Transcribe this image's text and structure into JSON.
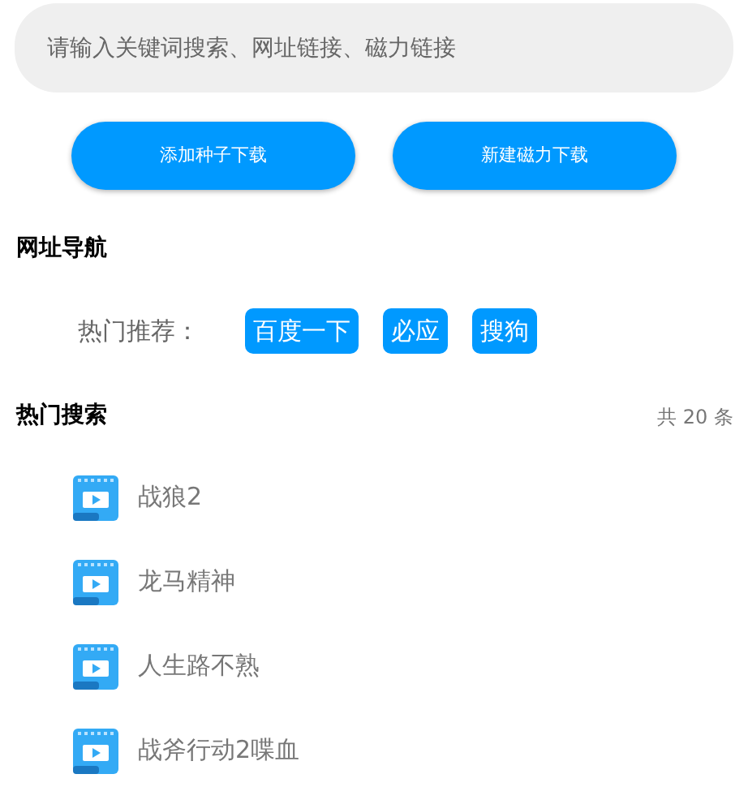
{
  "search": {
    "placeholder": "请输入关键词搜索、网址链接、磁力链接"
  },
  "buttons": [
    "添加种子下载",
    "新建磁力下载"
  ],
  "nav": {
    "title": "网址导航",
    "label": "热门推荐：",
    "links": [
      "百度一下",
      "必应",
      "搜狗"
    ]
  },
  "hot": {
    "title": "热门搜索",
    "count": "共 20 条",
    "items": [
      {
        "title": "战狼2"
      },
      {
        "title": "龙马精神"
      },
      {
        "title": "人生路不熟"
      },
      {
        "title": "战斧行动2喋血"
      }
    ]
  }
}
